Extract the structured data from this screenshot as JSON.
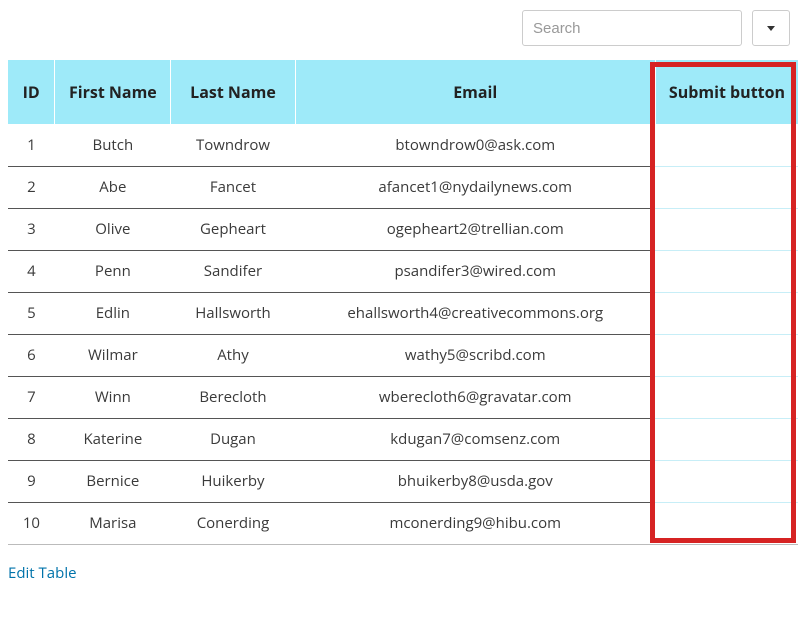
{
  "toolbar": {
    "search_placeholder": "Search"
  },
  "table": {
    "headers": {
      "id": "ID",
      "first_name": "First Name",
      "last_name": "Last Name",
      "email": "Email",
      "submit": "Submit button"
    },
    "rows": [
      {
        "id": "1",
        "first_name": "Butch",
        "last_name": "Towndrow",
        "email": "btowndrow0@ask.com",
        "submit": ""
      },
      {
        "id": "2",
        "first_name": "Abe",
        "last_name": "Fancet",
        "email": "afancet1@nydailynews.com",
        "submit": ""
      },
      {
        "id": "3",
        "first_name": "Olive",
        "last_name": "Gepheart",
        "email": "ogepheart2@trellian.com",
        "submit": ""
      },
      {
        "id": "4",
        "first_name": "Penn",
        "last_name": "Sandifer",
        "email": "psandifer3@wired.com",
        "submit": ""
      },
      {
        "id": "5",
        "first_name": "Edlin",
        "last_name": "Hallsworth",
        "email": "ehallsworth4@creativecommons.org",
        "submit": ""
      },
      {
        "id": "6",
        "first_name": "Wilmar",
        "last_name": "Athy",
        "email": "wathy5@scribd.com",
        "submit": ""
      },
      {
        "id": "7",
        "first_name": "Winn",
        "last_name": "Berecloth",
        "email": "wberecloth6@gravatar.com",
        "submit": ""
      },
      {
        "id": "8",
        "first_name": "Katerine",
        "last_name": "Dugan",
        "email": "kdugan7@comsenz.com",
        "submit": ""
      },
      {
        "id": "9",
        "first_name": "Bernice",
        "last_name": "Huikerby",
        "email": "bhuikerby8@usda.gov",
        "submit": ""
      },
      {
        "id": "10",
        "first_name": "Marisa",
        "last_name": "Conerding",
        "email": "mconerding9@hibu.com",
        "submit": ""
      }
    ]
  },
  "footer": {
    "edit_link": "Edit Table"
  },
  "highlight": {
    "color": "#d62323"
  }
}
